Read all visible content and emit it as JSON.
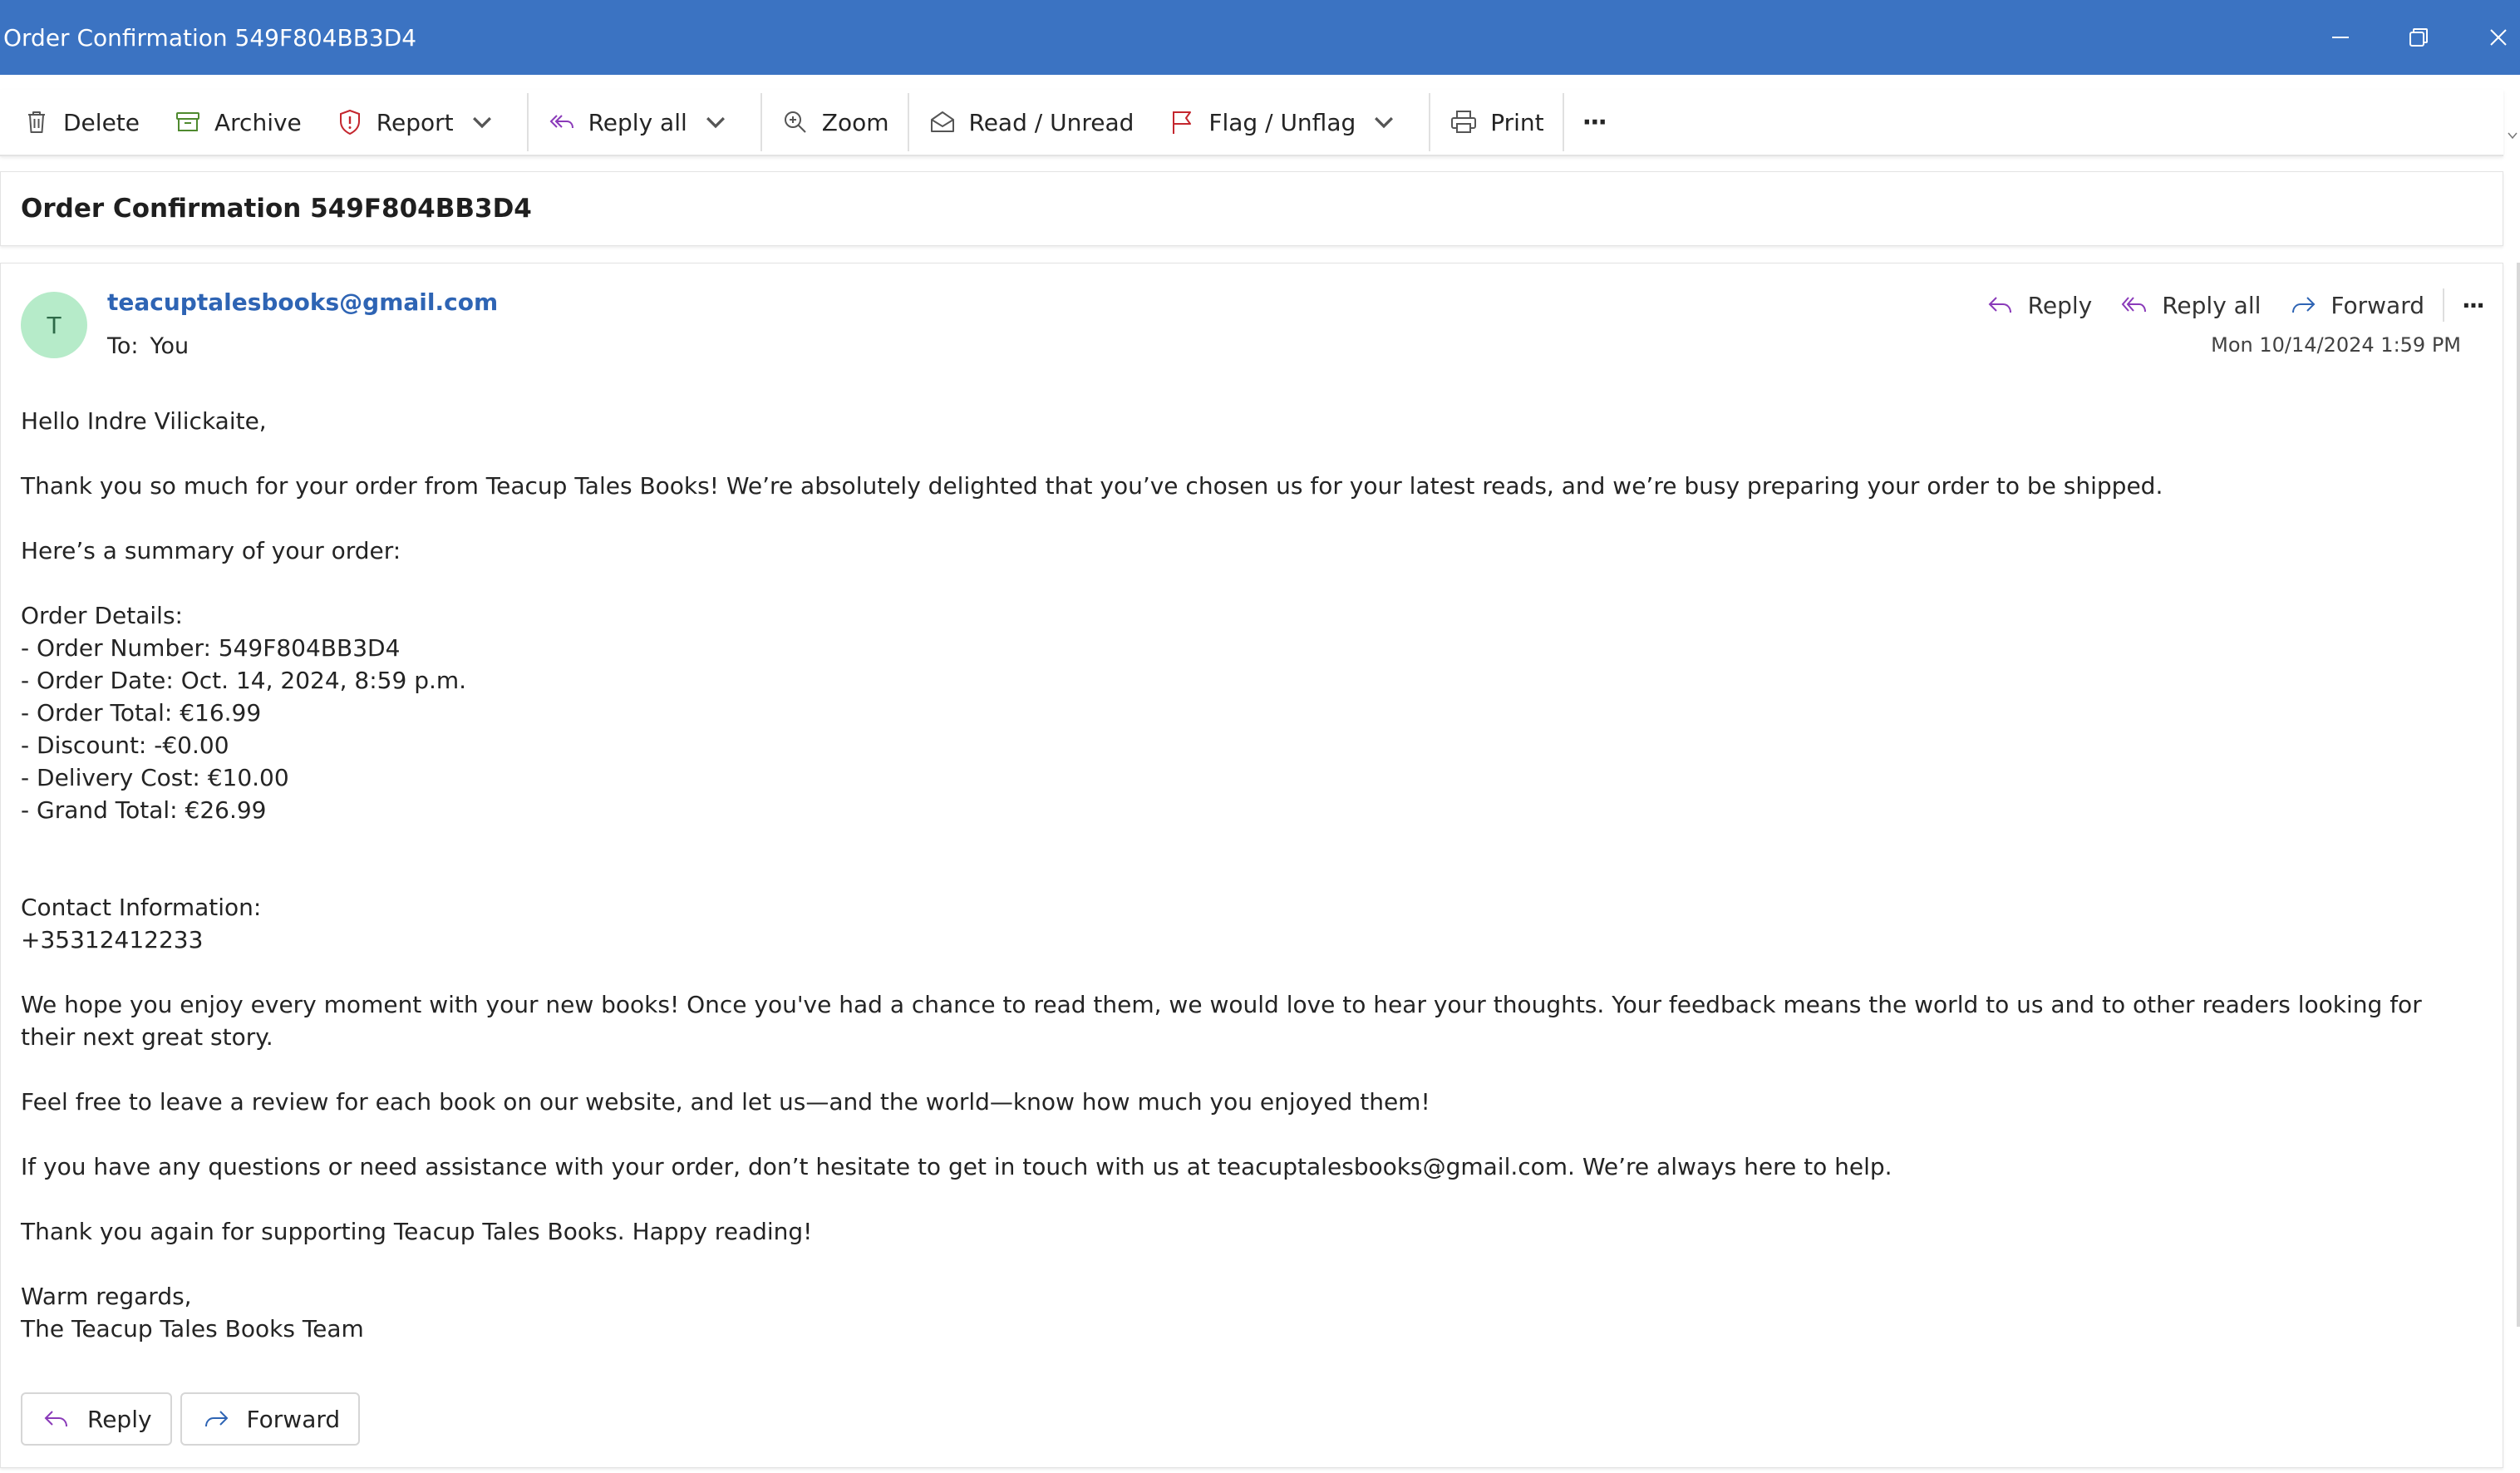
{
  "window": {
    "title": "Order Confirmation 549F804BB3D4"
  },
  "ribbon": {
    "delete": "Delete",
    "archive": "Archive",
    "report": "Report",
    "reply_all": "Reply all",
    "zoom": "Zoom",
    "read_unread": "Read / Unread",
    "flag_unflag": "Flag / Unflag",
    "print": "Print",
    "more": "···"
  },
  "subject": "Order Confirmation 549F804BB3D4",
  "message": {
    "avatar_initial": "T",
    "sender": "teacuptalesbooks@gmail.com",
    "to_label": "To:",
    "to_value": "You",
    "datetime": "Mon 10/14/2024 1:59 PM",
    "actions": {
      "reply": "Reply",
      "reply_all": "Reply all",
      "forward": "Forward",
      "more": "···"
    },
    "body": {
      "greeting": "Hello Indre Vilickaite,",
      "intro": "Thank you so much for your order from Teacup Tales Books! We’re absolutely delighted that you’ve chosen us for your latest reads, and we’re busy preparing your order to be shipped.",
      "summary_heading": "Here’s a summary of your order:",
      "order_details_heading": "Order Details:",
      "order_lines": [
        "- Order Number: 549F804BB3D4",
        "- Order Date: Oct. 14, 2024, 8:59 p.m.",
        "- Order Total: €16.99",
        "- Discount: -€0.00",
        "- Delivery Cost: €10.00",
        "- Grand Total: €26.99"
      ],
      "contact_heading": "Contact Information:",
      "contact_phone": "+35312412233",
      "enjoy": "We hope you enjoy every moment with your new books! Once you've had a chance to read them, we would love to hear your thoughts. Your feedback means the world to us and to other readers looking for their next great story.",
      "review": "Feel free to leave a review for each book on our website, and let us—and the world—know how much you enjoyed them!",
      "questions": "If you have any questions or need assistance with your order, don’t hesitate to get in touch with us at teacuptalesbooks@gmail.com. We’re always here to help.",
      "thanks": "Thank you again for supporting Teacup Tales Books. Happy reading!",
      "signoff": "Warm regards,",
      "signature": "The Teacup Tales Books Team"
    }
  },
  "bottom_actions": {
    "reply": "Reply",
    "forward": "Forward"
  },
  "colors": {
    "titlebar": "#3b73c2",
    "link": "#2e64b4",
    "reply_icon": "#8a3ab9",
    "forward_icon": "#2e64b4",
    "report_icon": "#c4262e",
    "archive_icon": "#4f8a2f",
    "flag_icon": "#c4262e",
    "avatar_bg": "#b6ebc9"
  }
}
